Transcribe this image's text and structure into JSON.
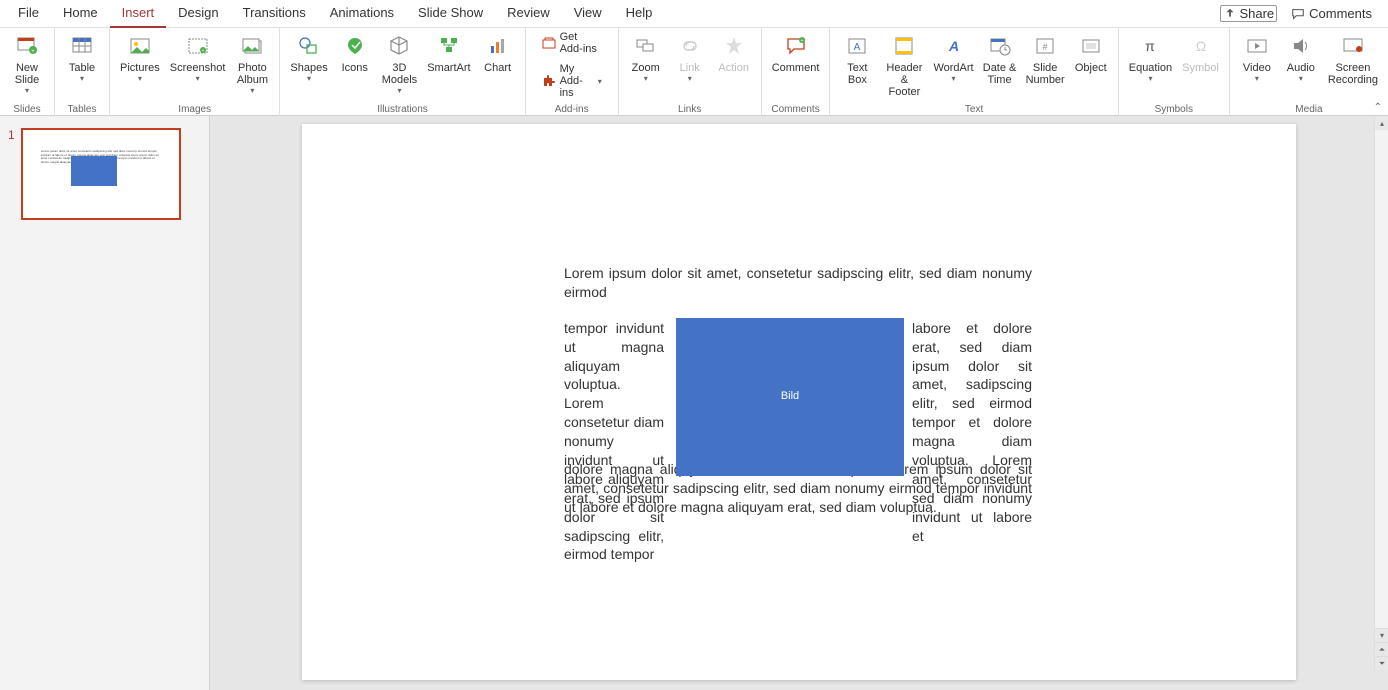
{
  "tabs": {
    "items": [
      "File",
      "Home",
      "Insert",
      "Design",
      "Transitions",
      "Animations",
      "Slide Show",
      "Review",
      "View",
      "Help"
    ],
    "active_index": 2
  },
  "top_right": {
    "share": "Share",
    "comments": "Comments"
  },
  "ribbon": {
    "groups": {
      "slides": {
        "label": "Slides",
        "new_slide": "New\nSlide"
      },
      "tables": {
        "label": "Tables",
        "table": "Table"
      },
      "images": {
        "label": "Images",
        "pictures": "Pictures",
        "screenshot": "Screenshot",
        "photo_album": "Photo\nAlbum"
      },
      "illustrations": {
        "label": "Illustrations",
        "shapes": "Shapes",
        "icons": "Icons",
        "models": "3D\nModels",
        "smartart": "SmartArt",
        "chart": "Chart"
      },
      "addins": {
        "label": "Add-ins",
        "get": "Get Add-ins",
        "my": "My Add-ins"
      },
      "links": {
        "label": "Links",
        "zoom": "Zoom",
        "link": "Link",
        "action": "Action"
      },
      "comments": {
        "label": "Comments",
        "comment": "Comment"
      },
      "text": {
        "label": "Text",
        "text_box": "Text\nBox",
        "header_footer": "Header\n& Footer",
        "wordart": "WordArt",
        "date_time": "Date &\nTime",
        "slide_number": "Slide\nNumber",
        "object": "Object"
      },
      "symbols": {
        "label": "Symbols",
        "equation": "Equation",
        "symbol": "Symbol"
      },
      "media": {
        "label": "Media",
        "video": "Video",
        "audio": "Audio",
        "screen_recording": "Screen\nRecording"
      }
    }
  },
  "thumb": {
    "number": "1"
  },
  "slide": {
    "top_line": "Lorem ipsum dolor sit amet, consetetur sadipscing elitr, sed diam nonumy eirmod",
    "left_col": "tempor invidunt ut magna aliquyam voluptua. Lorem consetetur diam nonumy invidunt ut labore aliquyam erat, sed ipsum dolor sit sadipscing elitr, eirmod tempor",
    "right_col": "labore et dolore erat, sed diam ipsum dolor sit amet, sadipscing elitr, sed eirmod tempor et dolore magna diam voluptua. Lorem amet, consetetur sed diam nonumy invidunt ut labore et",
    "bottom": "dolore magna aliquyam erat, sed diam voluptua. Lorem ipsum dolor sit amet, consetetur sadipscing elitr, sed diam nonumy eirmod tempor invidunt ut labore et dolore magna aliquyam erat, sed diam voluptua.",
    "image_label": "Bild"
  }
}
